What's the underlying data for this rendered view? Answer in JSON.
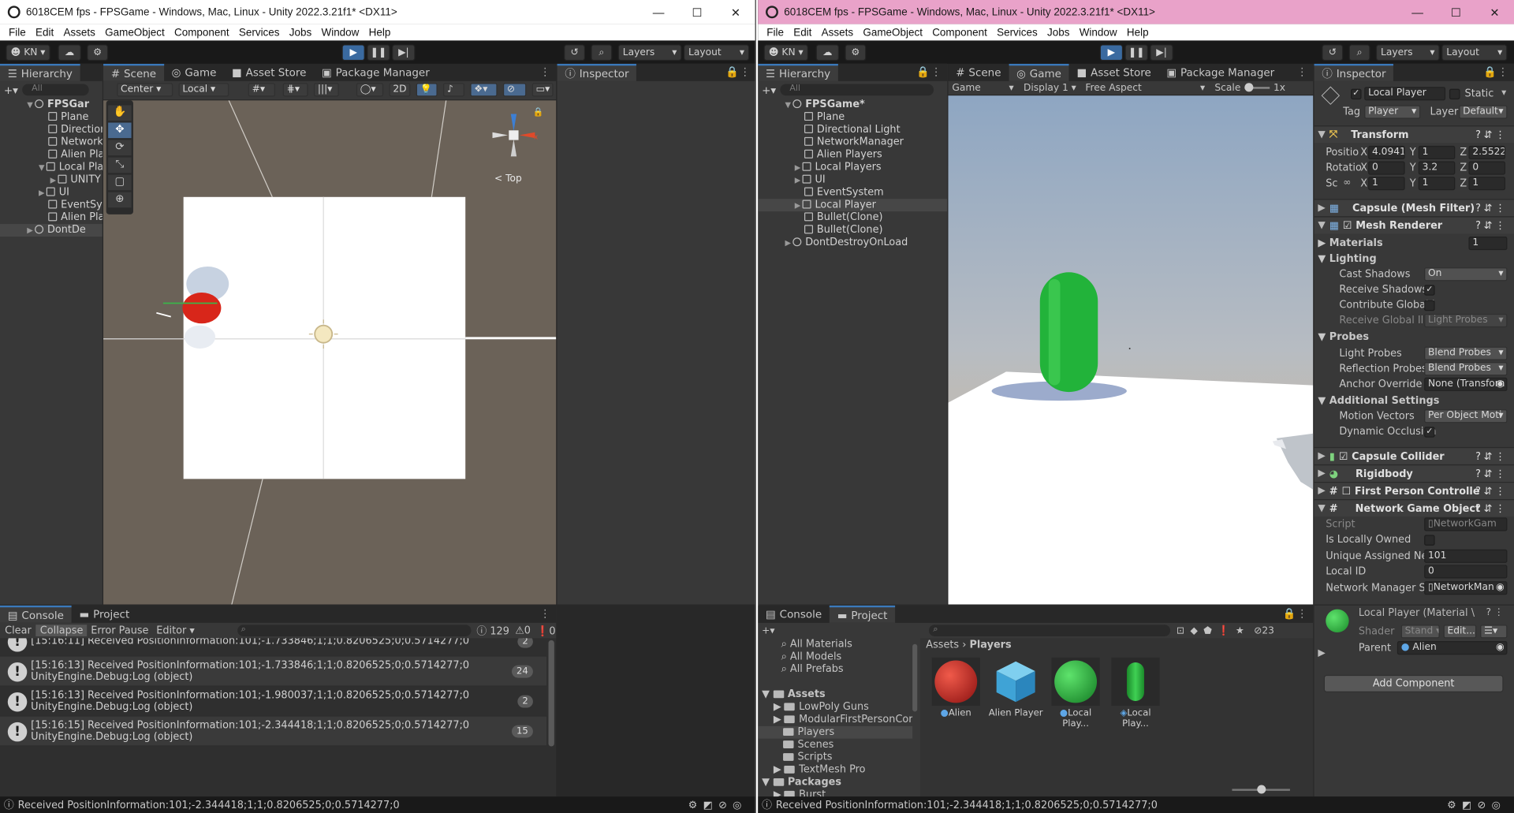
{
  "left_window": {
    "title": "6018CEM fps - FPSGame - Windows, Mac, Linux - Unity 2022.3.21f1* <DX11>",
    "menu": [
      "File",
      "Edit",
      "Assets",
      "GameObject",
      "Component",
      "Services",
      "Jobs",
      "Window",
      "Help"
    ],
    "account": "KN",
    "layers_label": "Layers",
    "layout_label": "Layout",
    "hierarchy_tab": "Hierarchy",
    "search_placeholder": "All",
    "hierarchy": [
      "FPSGar",
      "Plane",
      "Direction",
      "Networkl",
      "Alien Pla",
      "Local Pla",
      "UNITY",
      "UI",
      "EventSys",
      "Alien Pla",
      "DontDe"
    ],
    "scene_tabs": [
      "Scene",
      "Game",
      "Asset Store",
      "Package Manager"
    ],
    "scene_toolbar": {
      "pivot": "Center",
      "space": "Local",
      "mode2d": "2D"
    },
    "gizmo_label": "< Top",
    "inspector_tab": "Inspector",
    "console_tabs": [
      "Console",
      "Project"
    ],
    "console_buttons": [
      "Clear",
      "Collapse",
      "Error Pause",
      "Editor"
    ],
    "counts": {
      "log": "129",
      "warn": "0",
      "error": "0"
    },
    "logs": [
      {
        "line1": "[15:16:11] Received PositionInformation:101;-1.733846;1;1;0.8206525;0;0.5714277;0",
        "line2": "",
        "count": "2"
      },
      {
        "line1": "[15:16:13] Received PositionInformation:101;-1.733846;1;1;0.8206525;0;0.5714277;0",
        "line2": "UnityEngine.Debug:Log (object)",
        "count": "24"
      },
      {
        "line1": "[15:16:13] Received PositionInformation:101;-1.980037;1;1;0.8206525;0;0.5714277;0",
        "line2": "UnityEngine.Debug:Log (object)",
        "count": "2"
      },
      {
        "line1": "[15:16:15] Received PositionInformation:101;-2.344418;1;1;0.8206525;0;0.5714277;0",
        "line2": "UnityEngine.Debug:Log (object)",
        "count": "15"
      }
    ],
    "status": "Received PositionInformation:101;-2.344418;1;1;0.8206525;0;0.5714277;0"
  },
  "right_window": {
    "title": "6018CEM fps - FPSGame - Windows, Mac, Linux - Unity 2022.3.21f1* <DX11>",
    "title_color": "#e9a2c9",
    "hierarchy": [
      {
        "name": "FPSGame*",
        "arrow": "▼"
      },
      {
        "name": "Plane",
        "arrow": ""
      },
      {
        "name": "Directional Light",
        "arrow": ""
      },
      {
        "name": "NetworkManager",
        "arrow": ""
      },
      {
        "name": "Alien Players",
        "arrow": ""
      },
      {
        "name": "Local Players",
        "arrow": "▶"
      },
      {
        "name": "UI",
        "arrow": "▶"
      },
      {
        "name": "EventSystem",
        "arrow": ""
      },
      {
        "name": "Local Player",
        "arrow": "▶"
      },
      {
        "name": "Bullet(Clone)",
        "arrow": ""
      },
      {
        "name": "Bullet(Clone)",
        "arrow": ""
      },
      {
        "name": "DontDestroyOnLoad",
        "arrow": "▶"
      }
    ],
    "game_tabs": [
      "Scene",
      "Game",
      "Asset Store",
      "Package Manager"
    ],
    "game_toolbar": {
      "view": "Game",
      "display": "Display 1",
      "aspect": "Free Aspect",
      "scale_label": "Scale",
      "scale": "1x"
    },
    "inspector": {
      "tab": "Inspector",
      "object_name": "Local Player",
      "static": "Static",
      "tag_label": "Tag",
      "tag": "Player",
      "layer_label": "Layer",
      "layer": "Default",
      "transform": {
        "title": "Transform",
        "position": {
          "label": "Positio",
          "x": "4.0941",
          "y": "1",
          "z": "2.5522"
        },
        "rotation": {
          "label": "Rotatio",
          "x": "0",
          "y": "3.2",
          "z": "0"
        },
        "scale": {
          "label": "Sc",
          "x": "1",
          "y": "1",
          "z": "1"
        }
      },
      "mesh_filter": "Capsule (Mesh Filter)",
      "mesh_renderer": "Mesh Renderer",
      "materials_label": "Materials",
      "materials_count": "1",
      "lighting": "Lighting",
      "cast_shadows_label": "Cast Shadows",
      "cast_shadows": "On",
      "receive_shadows": "Receive Shadows",
      "contribute_gi": "Contribute Global I",
      "receive_gi": "Receive Global Illu",
      "receive_gi_value": "Light Probes",
      "probes": "Probes",
      "light_probes_label": "Light Probes",
      "light_probes": "Blend Probes",
      "reflection_probes_label": "Reflection Probes",
      "reflection_probes": "Blend Probes",
      "anchor_label": "Anchor Override",
      "anchor": "None (Transforn",
      "additional": "Additional Settings",
      "motion_label": "Motion Vectors",
      "motion": "Per Object Moti",
      "dynamic_occlusion": "Dynamic Occlusion",
      "capsule_collider": "Capsule Collider",
      "rigidbody": "Rigidbody",
      "fpc": "First Person Controlle",
      "network_go": "Network Game Object",
      "script_label": "Script",
      "script": "NetworkGam",
      "locally_owned": "Is Locally Owned",
      "unique_label": "Unique Assigned Net",
      "unique": "101",
      "local_id_label": "Local ID",
      "local_id": "0",
      "nm_label": "Network Manager Sc",
      "nm": "NetworkMan",
      "material": "Local Player (Material \\",
      "shader_label": "Shader",
      "shader": "Stand",
      "edit": "Edit...",
      "parent_label": "Parent",
      "parent": "Alien",
      "add_component": "Add Component"
    },
    "project": {
      "tabs": [
        "Console",
        "Project"
      ],
      "count": "23",
      "favorites": [
        "All Materials",
        "All Models",
        "All Prefabs"
      ],
      "tree": [
        "Assets",
        "LowPoly Guns",
        "ModularFirstPersonContrc",
        "Players",
        "Scenes",
        "Scripts",
        "TextMesh Pro",
        "Packages",
        "Burst"
      ],
      "breadcrumb": [
        "Assets",
        "Players"
      ],
      "assets": [
        "Alien",
        "Alien Player",
        "Local Play...",
        "Local Play..."
      ]
    },
    "status": "Received PositionInformation:101;-2.344418;1;1;0.8206525;0;0.5714277;0"
  },
  "colors": {
    "capsule_green": "#22b33a",
    "sphere_red": "#d8261a",
    "sky": "#8ea6c2",
    "accent": "#3a79bb"
  }
}
